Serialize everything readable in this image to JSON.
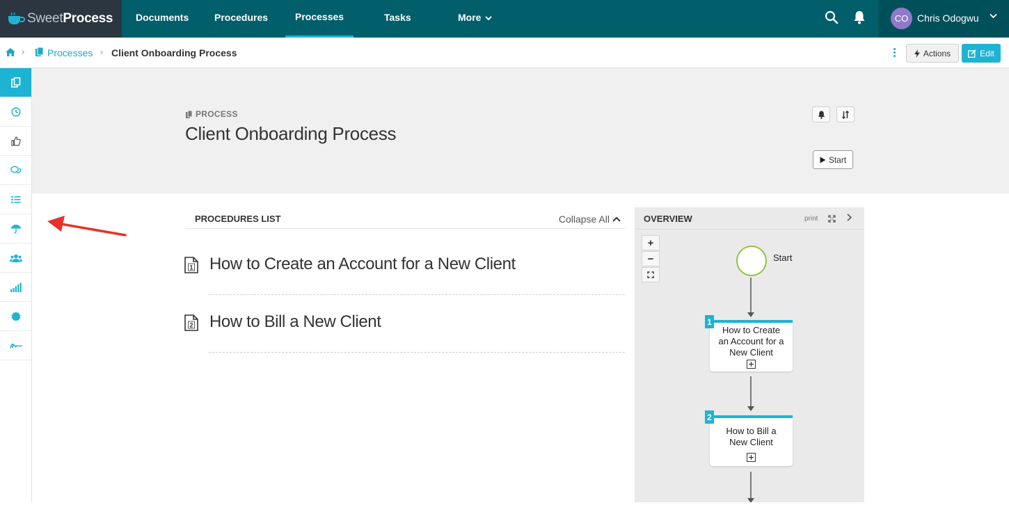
{
  "brand": {
    "name_light": "Sweet",
    "name_bold": "Process"
  },
  "nav": {
    "items": [
      {
        "label": "Documents"
      },
      {
        "label": "Procedures"
      },
      {
        "label": "Processes"
      },
      {
        "label": "Tasks"
      },
      {
        "label": "More"
      }
    ],
    "active": "Processes",
    "icons": [
      "search-icon",
      "bell-icon"
    ]
  },
  "user": {
    "initials": "CO",
    "name": "Chris Odogwu"
  },
  "breadcrumb": {
    "home_icon": "home-icon",
    "section": "Processes",
    "current": "Client Onboarding Process"
  },
  "toolbar": {
    "actions_label": "Actions",
    "edit_label": "Edit"
  },
  "sidebar": {
    "icons": [
      "documents-icon",
      "clock-icon",
      "thumbs-up-icon",
      "comments-icon",
      "list-icon",
      "umbrella-icon",
      "users-icon",
      "signal-icon",
      "badge-icon",
      "signature-icon"
    ]
  },
  "header": {
    "kicker": "PROCESS",
    "title": "Client Onboarding Process",
    "start_label": "Start"
  },
  "procedures": {
    "heading": "PROCEDURES LIST",
    "collapse_label": "Collapse All",
    "items": [
      {
        "number": "1",
        "label": "How to Create an Account for a New Client"
      },
      {
        "number": "2",
        "label": "How to Bill a New Client"
      }
    ]
  },
  "overview": {
    "heading": "OVERVIEW",
    "print_label": "print",
    "zoom_in": "+",
    "zoom_out": "−",
    "start_node": "Start",
    "steps": [
      {
        "number": "1",
        "lines": [
          "How to Create",
          "an Account for a",
          "New Client"
        ]
      },
      {
        "number": "2",
        "lines": [
          "How to Bill a",
          "New Client"
        ]
      }
    ]
  },
  "colors": {
    "nav_bg": "#005f6b",
    "accent": "#1fb3d3",
    "annotation_arrow": "#e8312a",
    "start_node_border": "#8cc63f"
  }
}
